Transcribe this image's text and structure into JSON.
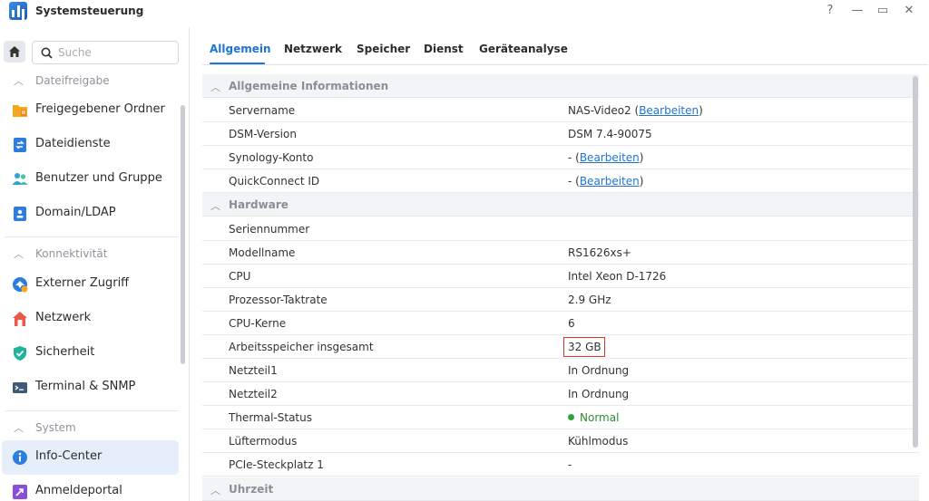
{
  "window": {
    "title": "Systemsteuerung",
    "controls": {
      "help": "?",
      "minimize": "—",
      "maximize": "▭",
      "close": "✕"
    }
  },
  "sidebar": {
    "search_placeholder": "Suche",
    "sections": [
      {
        "label": "Dateifreigabe",
        "items": [
          "Freigegebener Ordner",
          "Dateidienste",
          "Benutzer und Gruppe",
          "Domain/LDAP"
        ]
      },
      {
        "label": "Konnektivität",
        "items": [
          "Externer Zugriff",
          "Netzwerk",
          "Sicherheit",
          "Terminal & SNMP"
        ]
      },
      {
        "label": "System",
        "items": [
          "Info-Center",
          "Anmeldeportal"
        ]
      }
    ],
    "active_item": "Info-Center"
  },
  "tabs": [
    "Allgemein",
    "Netzwerk",
    "Speicher",
    "Dienst",
    "Geräteanalyse"
  ],
  "active_tab": "Allgemein",
  "groups": {
    "general": {
      "title": "Allgemeine Informationen",
      "rows": [
        {
          "key": "Servername",
          "value": "NAS-Video2 (",
          "link": "Bearbeiten",
          "suffix": ")"
        },
        {
          "key": "DSM-Version",
          "value": "DSM 7.4-90075"
        },
        {
          "key": "Synology-Konto",
          "value": "- (",
          "link": "Bearbeiten",
          "suffix": ")"
        },
        {
          "key": "QuickConnect ID",
          "value": "- (",
          "link": "Bearbeiten",
          "suffix": ")"
        }
      ]
    },
    "hardware": {
      "title": "Hardware",
      "rows": [
        {
          "key": "Seriennummer",
          "value": ""
        },
        {
          "key": "Modellname",
          "value": "RS1626xs+"
        },
        {
          "key": "CPU",
          "value": "Intel Xeon D-1726"
        },
        {
          "key": "Prozessor-Taktrate",
          "value": "2.9 GHz"
        },
        {
          "key": "CPU-Kerne",
          "value": "6"
        },
        {
          "key": "Arbeitsspeicher insgesamt",
          "value": "32 GB"
        },
        {
          "key": "Netzteil1",
          "value": "In Ordnung"
        },
        {
          "key": "Netzteil2",
          "value": "In Ordnung"
        },
        {
          "key": "Thermal-Status",
          "value": "Normal"
        },
        {
          "key": "Lüftermodus",
          "value": "Kühlmodus"
        },
        {
          "key": "PCIe-Steckplatz 1",
          "value": "-"
        }
      ]
    },
    "time": {
      "title": "Uhrzeit"
    }
  },
  "colors": {
    "accent": "#1f74d2",
    "highlight": "#d9342b",
    "status_ok": "#2fa33b"
  }
}
